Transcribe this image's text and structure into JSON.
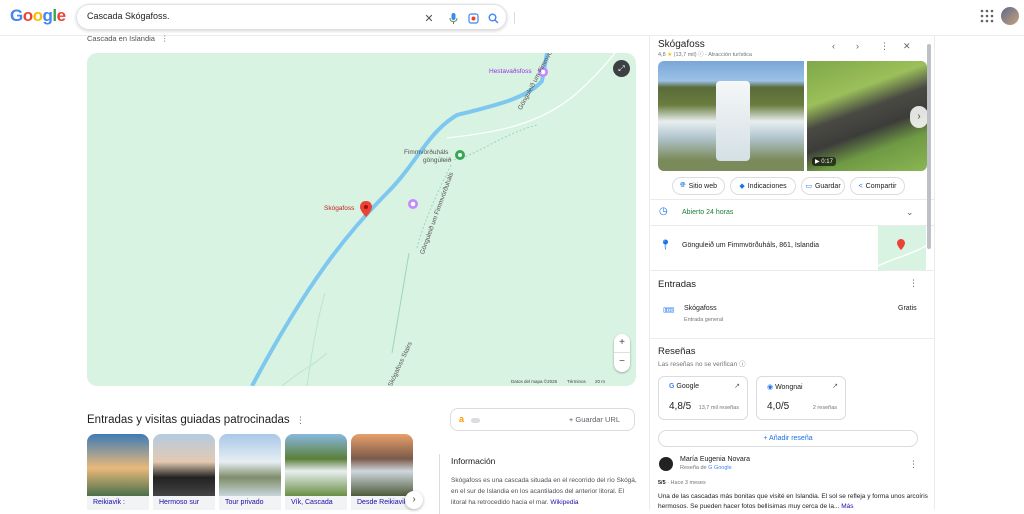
{
  "header": {
    "logo": "Google",
    "search_value": "Cascada Skógafoss.",
    "clear_icon": "close-icon",
    "voice_icon": "microphone-icon",
    "lens_icon": "camera-lens-icon",
    "search_icon": "search-icon"
  },
  "left": {
    "breadcrumb": "Cascada en Islandia",
    "map": {
      "labels": {
        "hestavad": "Hestavaðsfoss",
        "fimm_1": "Fimmvörðuháls",
        "fimm_2": "gönguleið",
        "skogafoss": "Skógafoss",
        "trail_a": "Gönguleið um Fimmvörðuháls",
        "trail_b": "Gönguleið um Fimmvörðuháls",
        "stairs": "Skógafoss Stairs"
      },
      "footer_data": "Datos del mapa ©2026",
      "footer_terms": "Términos",
      "footer_scale": "20 m"
    },
    "sponsored_title": "Entradas y visitas guiadas patrocinadas",
    "tours": [
      {
        "caption": "Reikiavik :"
      },
      {
        "caption": "Hermoso sur"
      },
      {
        "caption": "Tour privado"
      },
      {
        "caption": "Vík, Cascada"
      },
      {
        "caption": "Desde Reikiavik"
      }
    ],
    "save_url": "Guardar URL",
    "info_title": "Información",
    "info_text": "Skógafoss es una cascada situada en el recorrido del río Skógá, en el sur de Islandia en los acantilados del anterior litoral. El litoral ha retrocedido hacia el mar.",
    "info_link": "Wikipedia"
  },
  "panel": {
    "title": "Skógafoss",
    "rating": "4,8",
    "rating_count": "(13,7 mil)",
    "category": "Atracción turística",
    "video_duration": "0:17",
    "actions": [
      "Sitio web",
      "Indicaciones",
      "Guardar",
      "Compartir"
    ],
    "hours": "Abierto 24 horas",
    "address": "Gönguleið um Fimmvörðuháls, 861, Islandia",
    "tickets_title": "Entradas",
    "ticket_name": "Skógafoss",
    "ticket_sub": "Entrada general",
    "ticket_price": "Gratis",
    "reviews_title": "Reseñas",
    "reviews_sub": "Las reseñas no se verifican",
    "sources": [
      {
        "name": "Google",
        "score": "4,8/5",
        "count": "13,7 mil reseñas"
      },
      {
        "name": "Wongnai",
        "score": "4,0/5",
        "count": "2 reseñas"
      }
    ],
    "add_review": "Añadir reseña",
    "reviewer_name": "María Eugenia Novara",
    "reviewer_sub_prefix": "Reseña de",
    "reviewer_sub_source": "Google",
    "review_score": "5/5",
    "review_time": "Hace 3 meses",
    "review_text": "Una de las cascadas más bonitas que visité en Islandia. El sol se refleja y forma unos arcoíris hermosos. Se pueden hacer fotos bellísimas muy cerca de la...",
    "review_more": "Más"
  },
  "colors": {
    "accent": "#1a73e8",
    "open": "#188038",
    "map_bg": "#d8f3e2",
    "river": "#7ec8f0",
    "pin": "#ea4335"
  }
}
